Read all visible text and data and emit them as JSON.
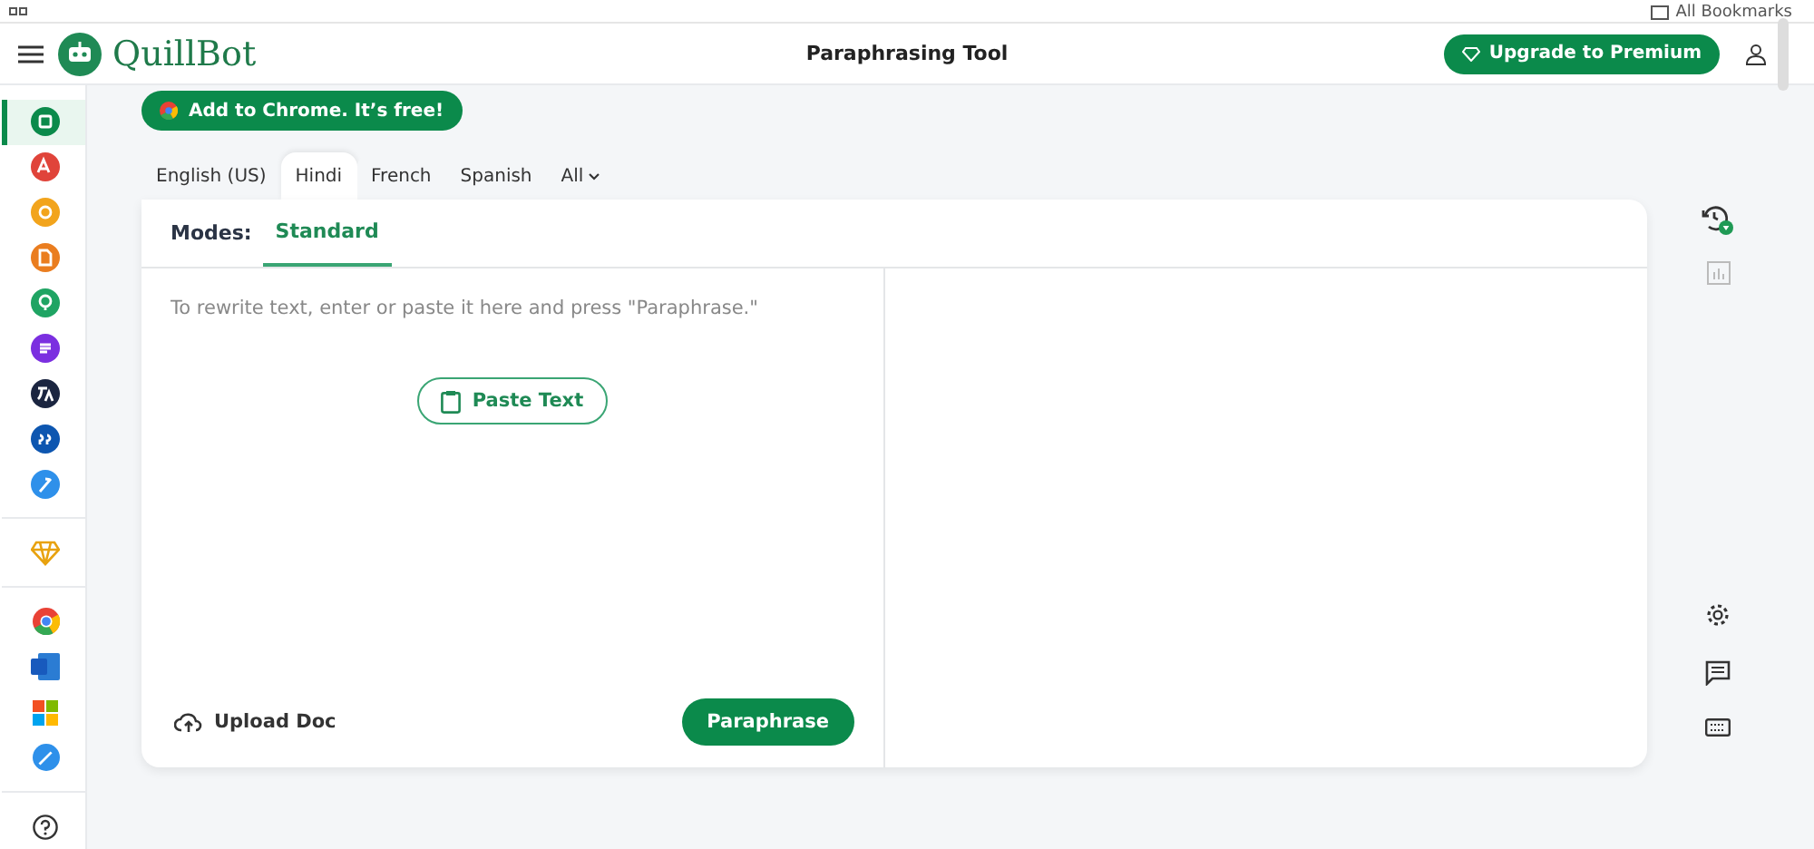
{
  "bookmarks_bar": {
    "label": "All Bookmarks"
  },
  "header": {
    "logo": "QuillBot",
    "title": "Paraphrasing Tool",
    "upgrade_button": "Upgrade to Premium"
  },
  "sidebar": {
    "tools": [
      {
        "color": "#0b8a4b",
        "selected": true
      },
      {
        "color": "#e0443a",
        "selected": false
      },
      {
        "color": "#f2a41c",
        "selected": false
      },
      {
        "color": "#ea7d1f",
        "selected": false
      },
      {
        "color": "#1fa463",
        "selected": false
      },
      {
        "color": "#7b2fe0",
        "selected": false
      },
      {
        "color": "#1b2540",
        "selected": false
      },
      {
        "color": "#0d56b0",
        "selected": false
      },
      {
        "color": "#2e90ea",
        "selected": false
      }
    ]
  },
  "chrome_banner": "Add to Chrome. It’s free!",
  "language_tabs": [
    {
      "label": "English (US)",
      "selected": false
    },
    {
      "label": "Hindi",
      "selected": true
    },
    {
      "label": "French",
      "selected": false
    },
    {
      "label": "Spanish",
      "selected": false
    },
    {
      "label": "All",
      "selected": false
    }
  ],
  "modes": {
    "label": "Modes:",
    "items": [
      {
        "label": "Standard",
        "selected": true
      }
    ]
  },
  "input": {
    "placeholder": "To rewrite text, enter or paste it here and press \"Paraphrase.\"",
    "paste_button": "Paste Text"
  },
  "footer": {
    "upload": "Upload Doc",
    "paraphrase_button": "Paraphrase"
  }
}
